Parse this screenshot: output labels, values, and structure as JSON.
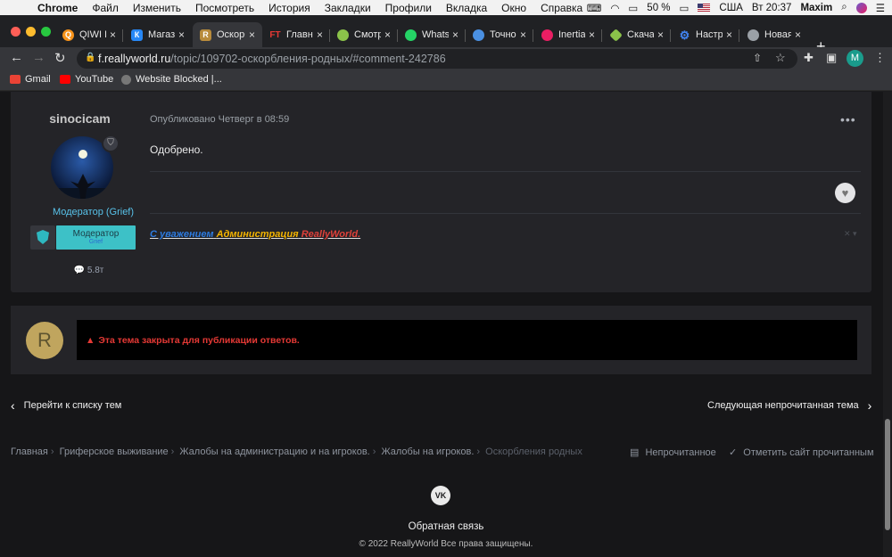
{
  "menubar": {
    "app": "Chrome",
    "items": [
      "Файл",
      "Изменить",
      "Посмотреть",
      "История",
      "Закладки",
      "Профили",
      "Вкладка",
      "Окно",
      "Справка"
    ],
    "battery": "50 %",
    "input_lang": "США",
    "clock": "Вт 20:37",
    "user": "Maxim"
  },
  "tabs": [
    {
      "label": "QIWI К",
      "icon": "qiwi-icon",
      "color": "#f7931a"
    },
    {
      "label": "Магаз",
      "icon": "vk-icon",
      "color": "#2787f5"
    },
    {
      "label": "Оскорб",
      "icon": "reallyworld-icon",
      "color": "#b88b3c"
    },
    {
      "label": "Главн",
      "icon": "ft-icon",
      "color": "#e53935"
    },
    {
      "label": "Смотр",
      "icon": "smotr-icon",
      "color": "#8bc34a"
    },
    {
      "label": "WhatsA",
      "icon": "whatsapp-icon",
      "color": "#25d366"
    },
    {
      "label": "Точно",
      "icon": "clock-icon",
      "color": "#4a90e2"
    },
    {
      "label": "Inertia",
      "icon": "inertia-icon",
      "color": "#e91e63"
    },
    {
      "label": "Скача",
      "icon": "download-icon",
      "color": "#8bc34a"
    },
    {
      "label": "Настр",
      "icon": "gear-icon",
      "color": "#4285f4"
    },
    {
      "label": "Новая",
      "icon": "chrome-icon",
      "color": "#9aa0a6"
    }
  ],
  "address": {
    "host": "f.reallyworld.ru",
    "path": "/topic/109702-оскорбления-родных/#comment-242786"
  },
  "profile_initial": "M",
  "bookmarks": [
    {
      "label": "Gmail",
      "icon": "gmail-icon"
    },
    {
      "label": "YouTube",
      "icon": "youtube-icon"
    },
    {
      "label": "Website Blocked |...",
      "icon": "globe-icon"
    }
  ],
  "post": {
    "author": "sinocicam",
    "group": "Модератор (Grief)",
    "rank_title": "Модератор",
    "rank_sub": "Grief",
    "post_count": "5.8т",
    "date": "Опубликовано Четверг в 08:59",
    "content": "Одобрено.",
    "signature": {
      "part1": "С уважением",
      "part2": "Администрация",
      "part3": "ReallyWorld."
    }
  },
  "closed_notice": {
    "avatar_letter": "R",
    "message": "Эта тема закрыта для публикации ответов."
  },
  "pager": {
    "prev": "Перейти к списку тем",
    "next": "Следующая непрочитанная тема"
  },
  "breadcrumbs": [
    "Главная",
    "Гриферское выживание",
    "Жалобы на администрацию и на игроков.",
    "Жалобы на игроков.",
    "Оскорбления родных"
  ],
  "breadcrumb_actions": {
    "unread": "Непрочитанное",
    "mark_read": "Отметить сайт прочитанным"
  },
  "footer": {
    "social": "VK",
    "feedback": "Обратная связь",
    "copyright": "© 2022 ReallyWorld Все права защищены."
  },
  "colors": {
    "accent_cyan": "#3dc1c7",
    "group_blue": "#58c2ea",
    "alert_red": "#e53935",
    "sig_blue": "#2d7be0",
    "sig_gold": "#f4b400",
    "sig_red": "#e0413a"
  }
}
